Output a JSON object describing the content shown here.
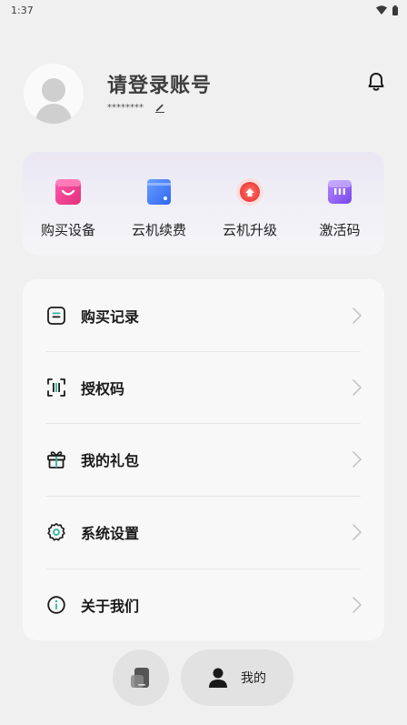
{
  "status_bar": {
    "time": "1:37"
  },
  "profile": {
    "title": "请登录账号",
    "masked_account": "********"
  },
  "quick_actions": [
    {
      "label": "购买设备",
      "icon": "shopping-bag-icon",
      "color": "#f0448f"
    },
    {
      "label": "云机续费",
      "icon": "wallet-icon",
      "color": "#3f7df6"
    },
    {
      "label": "云机升级",
      "icon": "upgrade-icon",
      "color": "#f5534f"
    },
    {
      "label": "激活码",
      "icon": "ticket-icon",
      "color": "#8a5cf0"
    }
  ],
  "menu": [
    {
      "label": "购买记录",
      "icon": "document-list-icon"
    },
    {
      "label": "授权码",
      "icon": "scan-code-icon"
    },
    {
      "label": "我的礼包",
      "icon": "gift-icon"
    },
    {
      "label": "系统设置",
      "icon": "gear-icon"
    },
    {
      "label": "关于我们",
      "icon": "info-icon"
    }
  ],
  "bottom_nav": {
    "phone_tab_icon": "cloud-phone-icon",
    "mine_label": "我的",
    "mine_icon": "user-icon"
  }
}
